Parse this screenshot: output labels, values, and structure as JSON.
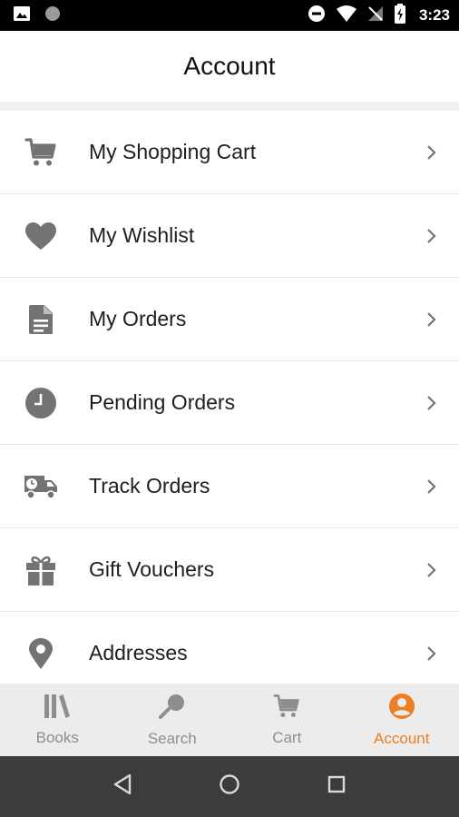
{
  "status": {
    "time": "3:23"
  },
  "header": {
    "title": "Account"
  },
  "menu": [
    {
      "label": "My Shopping Cart",
      "icon": "cart-icon"
    },
    {
      "label": "My Wishlist",
      "icon": "heart-icon"
    },
    {
      "label": "My Orders",
      "icon": "document-icon"
    },
    {
      "label": "Pending Orders",
      "icon": "clock-icon"
    },
    {
      "label": "Track Orders",
      "icon": "delivery-truck-icon"
    },
    {
      "label": "Gift Vouchers",
      "icon": "gift-icon"
    },
    {
      "label": "Addresses",
      "icon": "location-pin-icon"
    }
  ],
  "bottom_nav": [
    {
      "label": "Books",
      "icon": "books-icon"
    },
    {
      "label": "Search",
      "icon": "search-icon"
    },
    {
      "label": "Cart",
      "icon": "cart-icon"
    },
    {
      "label": "Account",
      "icon": "account-icon",
      "active": true
    }
  ],
  "colors": {
    "accent": "#ef7d22",
    "icon_gray": "#737373",
    "nav_gray": "#8e8e8e"
  }
}
